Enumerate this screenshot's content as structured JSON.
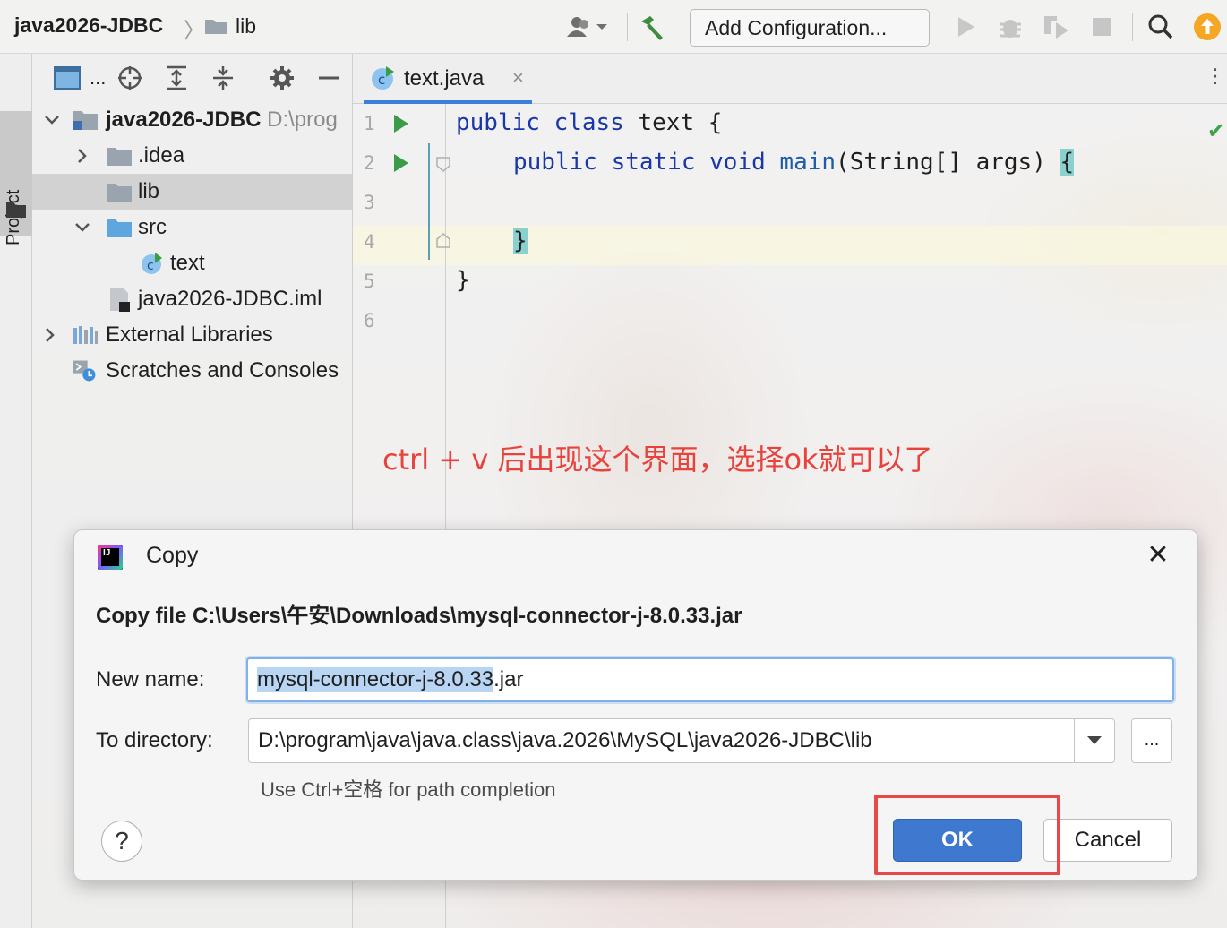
{
  "toolbar": {
    "project_name": "java2026-JDBC",
    "crumb_separator": "〉",
    "current_folder": "lib",
    "add_configuration_label": "Add Configuration...",
    "icons": [
      "user-icon",
      "hammer-build-icon",
      "run-icon",
      "debug-icon",
      "coverage-icon",
      "stop-icon",
      "search-icon",
      "update-icon"
    ]
  },
  "side_strip": {
    "project_tab_label": "Project"
  },
  "project_panel": {
    "toolbar_dots": "...",
    "tree": [
      {
        "label": "java2026-JDBC",
        "path": "D:\\prog",
        "expanded": true,
        "icon": "module-folder-icon"
      },
      {
        "label": ".idea",
        "expanded": false,
        "icon": "folder-icon"
      },
      {
        "label": "lib",
        "selected": true,
        "icon": "folder-icon"
      },
      {
        "label": "src",
        "expanded": true,
        "icon": "source-folder-icon"
      },
      {
        "label": "text",
        "icon": "java-class-icon"
      },
      {
        "label": "java2026-JDBC.iml",
        "icon": "iml-file-icon"
      },
      {
        "label": "External Libraries",
        "expanded": false,
        "icon": "libraries-icon"
      },
      {
        "label": "Scratches and Consoles",
        "icon": "scratches-icon"
      }
    ]
  },
  "editor": {
    "tab_label": "text.java",
    "tab_close": "×",
    "line_numbers": [
      "1",
      "2",
      "3",
      "4",
      "5",
      "6"
    ],
    "code": {
      "line1": {
        "kw": "public class",
        "rest": " text {"
      },
      "line2": {
        "kw": "public static void",
        "fn": "main",
        "rest": "(String[] args) ",
        "brace": "{"
      },
      "line4": {
        "brace": "}"
      },
      "line5": {
        "rest": "}"
      }
    }
  },
  "annotation": "ctrl + v 后出现这个界面，选择ok就可以了",
  "dialog": {
    "title": "Copy",
    "close": "✕",
    "heading": "Copy file C:\\Users\\午安\\Downloads\\mysql-connector-j-8.0.33.jar",
    "new_name_label": "New name:",
    "new_name_selected": "mysql-connector-j-8.0.33",
    "new_name_rest": ".jar",
    "to_directory_label": "To directory:",
    "to_directory_value": "D:\\program\\java\\java.class\\java.2026\\MySQL\\java2026-JDBC\\lib",
    "browse_label": "...",
    "hint": "Use Ctrl+空格 for path completion",
    "help_label": "?",
    "ok_label": "OK",
    "cancel_label": "Cancel"
  },
  "colors": {
    "annotation_red": "#e8423c",
    "ok_blue": "#3e79cf",
    "keyword_blue": "#1a37a8",
    "run_green": "#3a9c47",
    "highlight_box": "#e9484a"
  }
}
